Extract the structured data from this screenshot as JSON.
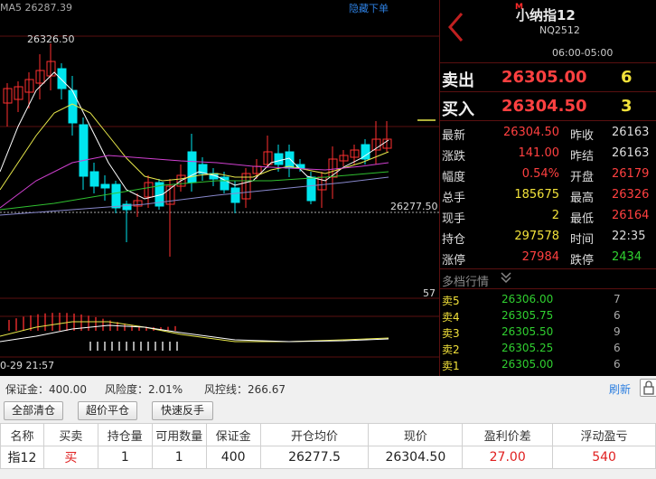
{
  "chart": {
    "ma_label": "MA5 26287.39",
    "hide_label": "隐藏下单",
    "high_label": "26326.50",
    "low_label": "26277.50",
    "volume_max": "57",
    "time_label": "0-29 21:57",
    "colors": {
      "up": "#ff3030",
      "down": "#00e5ee",
      "ma5": "#ffffff",
      "ma10": "#e8e84a",
      "ma20": "#d040d0",
      "ma30": "#30c030",
      "ma60": "#8888cc"
    }
  },
  "header": {
    "badge": "M",
    "title": "小纳指12",
    "code": "NQ2512",
    "hours": "06:00-05:00"
  },
  "ask": {
    "label": "卖出",
    "price": "26305.00",
    "qty": "6"
  },
  "bid": {
    "label": "买入",
    "price": "26304.50",
    "qty": "3"
  },
  "quote_rows": [
    {
      "k1": "最新",
      "v1": "26304.50",
      "c1": "red",
      "k2": "昨收",
      "v2": "26163",
      "c2": "wht"
    },
    {
      "k1": "涨跌",
      "v1": "141.00",
      "c1": "red",
      "k2": "昨结",
      "v2": "26163",
      "c2": "wht"
    },
    {
      "k1": "幅度",
      "v1": "0.54%",
      "c1": "red",
      "k2": "开盘",
      "v2": "26179",
      "c2": "red"
    },
    {
      "k1": "总手",
      "v1": "185675",
      "c1": "yel",
      "k2": "最高",
      "v2": "26326",
      "c2": "red"
    },
    {
      "k1": "现手",
      "v1": "2",
      "c1": "yel",
      "k2": "最低",
      "v2": "26164",
      "c2": "red"
    },
    {
      "k1": "持仓",
      "v1": "297578",
      "c1": "yel",
      "k2": "时间",
      "v2": "22:35",
      "c2": "wht"
    },
    {
      "k1": "涨停",
      "v1": "27984",
      "c1": "red",
      "k2": "跌停",
      "v2": "2434",
      "c2": "grn"
    }
  ],
  "depth": {
    "title": "多档行情",
    "rows": [
      {
        "k": "卖5",
        "p": "26306.00",
        "q": "7"
      },
      {
        "k": "卖4",
        "p": "26305.75",
        "q": "6"
      },
      {
        "k": "卖3",
        "p": "26305.50",
        "q": "9"
      },
      {
        "k": "卖2",
        "p": "26305.25",
        "q": "6"
      },
      {
        "k": "卖1",
        "p": "26305.00",
        "q": "6"
      }
    ]
  },
  "risk": {
    "margin": "保证金：400.00",
    "risk_ratio": "风险度：2.01%",
    "control_line": "风控线：266.67",
    "refresh": "刷新"
  },
  "actions": {
    "close_all": "全部清仓",
    "close_cap": "超价平仓",
    "reverse": "快速反手"
  },
  "positions": {
    "headers": [
      "名称",
      "买卖",
      "持仓量",
      "可用数量",
      "保证金",
      "开仓均价",
      "现价",
      "盈利价差",
      "浮动盈亏"
    ],
    "rows": [
      [
        "指12",
        "买",
        "1",
        "1",
        "400",
        "26277.5",
        "26304.50",
        "27.00",
        "540"
      ]
    ]
  }
}
